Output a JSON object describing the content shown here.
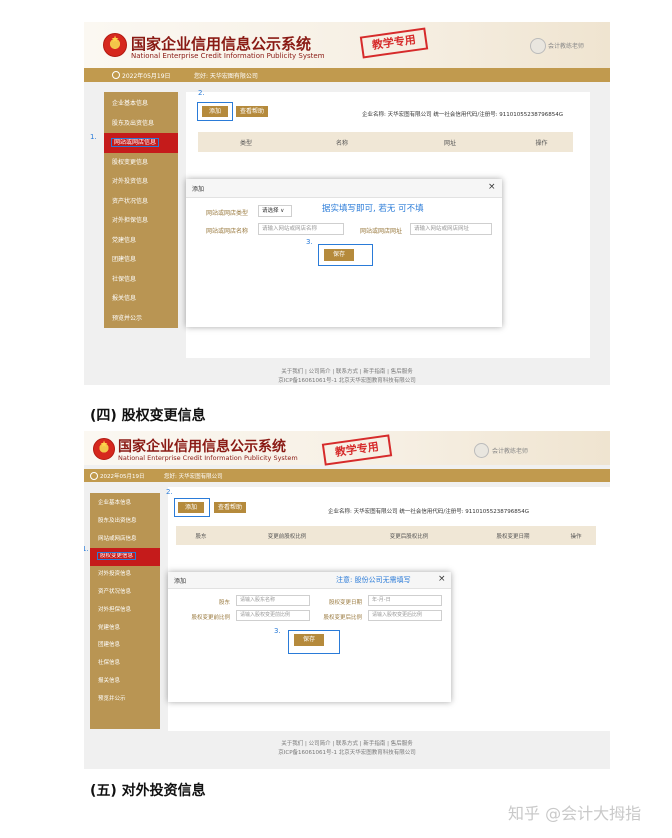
{
  "shot1": {
    "header": {
      "title_cn": "国家企业信用信息公示系统",
      "title_en": "National Enterprise Credit Information Publicity System",
      "stamp": "教学专用",
      "user": "会计教练老师"
    },
    "infobar": {
      "date": "2022年05月19日",
      "company": "您好: 天华宏图有限公司"
    },
    "sidebar": [
      "企业基本信息",
      "股东及出资信息",
      "网站或网店信息",
      "股权变更信息",
      "对外投资信息",
      "资产状况信息",
      "对外担保信息",
      "党建信息",
      "团建信息",
      "社保信息",
      "报关信息",
      "预览并公示"
    ],
    "active_index": 2,
    "toolbar": {
      "add": "添加",
      "view": "查看帮助"
    },
    "company_line": "企业名称: 天华宏图有限公司   统一社会信用代码/注册号: 91101055238796854G",
    "table_headers": [
      "类型",
      "名称",
      "网址",
      "操作"
    ],
    "dialog": {
      "title": "添加",
      "close": "×",
      "type_label": "网站或网店类型",
      "type_value": "请选择 ∨",
      "note": "据实填写即可, 若无 可不填",
      "name_label": "网站或网店名称",
      "name_placeholder": "请输入网站或网店名称",
      "url_label": "网站或网店网址",
      "url_placeholder": "请输入网站或网店网址",
      "save": "保存"
    },
    "steps": [
      "1.",
      "2.",
      "3."
    ],
    "footer": [
      "关于我们 | 公司简介 | 联系方式 | 新手指南 | 售后服务",
      "京ICP备16061061号-1 北京天华宏图教育科技有限公司"
    ]
  },
  "heading1": "(四) 股权变更信息",
  "shot2": {
    "header": {
      "title_cn": "国家企业信用信息公示系统",
      "title_en": "National Enterprise Credit Information Publicity System",
      "stamp": "教学专用",
      "user": "会计教练老师"
    },
    "infobar": {
      "date": "2022年05月19日",
      "company": "您好: 天华宏图有限公司"
    },
    "sidebar": [
      "企业基本信息",
      "股东及出资信息",
      "网站或网店信息",
      "股权变更信息",
      "对外投资信息",
      "资产状况信息",
      "对外担保信息",
      "党建信息",
      "团建信息",
      "社保信息",
      "报关信息",
      "预览并公示"
    ],
    "active_index": 3,
    "toolbar": {
      "add": "添加",
      "view": "查看帮助"
    },
    "company_line": "企业名称: 天华宏图有限公司   统一社会信用代码/注册号: 91101055238796854G",
    "table_headers": [
      "股东",
      "变更前股权比例",
      "变更后股权比例",
      "股权变更日期",
      "操作"
    ],
    "dialog": {
      "title": "添加",
      "close": "×",
      "note": "注意: 股份公司无需填写",
      "holder_label": "股东",
      "holder_placeholder": "请输入股东名称",
      "date_label": "股权变更日期",
      "date_placeholder": "年-月-日",
      "before_label": "股权变更前比例",
      "before_placeholder": "请输入股权变更前比例",
      "after_label": "股权变更后比例",
      "after_placeholder": "请输入股权变更后比例",
      "save": "保存"
    },
    "steps": [
      "1.",
      "2.",
      "3."
    ],
    "footer": [
      "关于我们 | 公司简介 | 联系方式 | 新手指南 | 售后服务",
      "京ICP备16061061号-1 北京天华宏图教育科技有限公司"
    ]
  },
  "heading2": "(五) 对外投资信息",
  "watermark": "知乎 @会计大拇指"
}
